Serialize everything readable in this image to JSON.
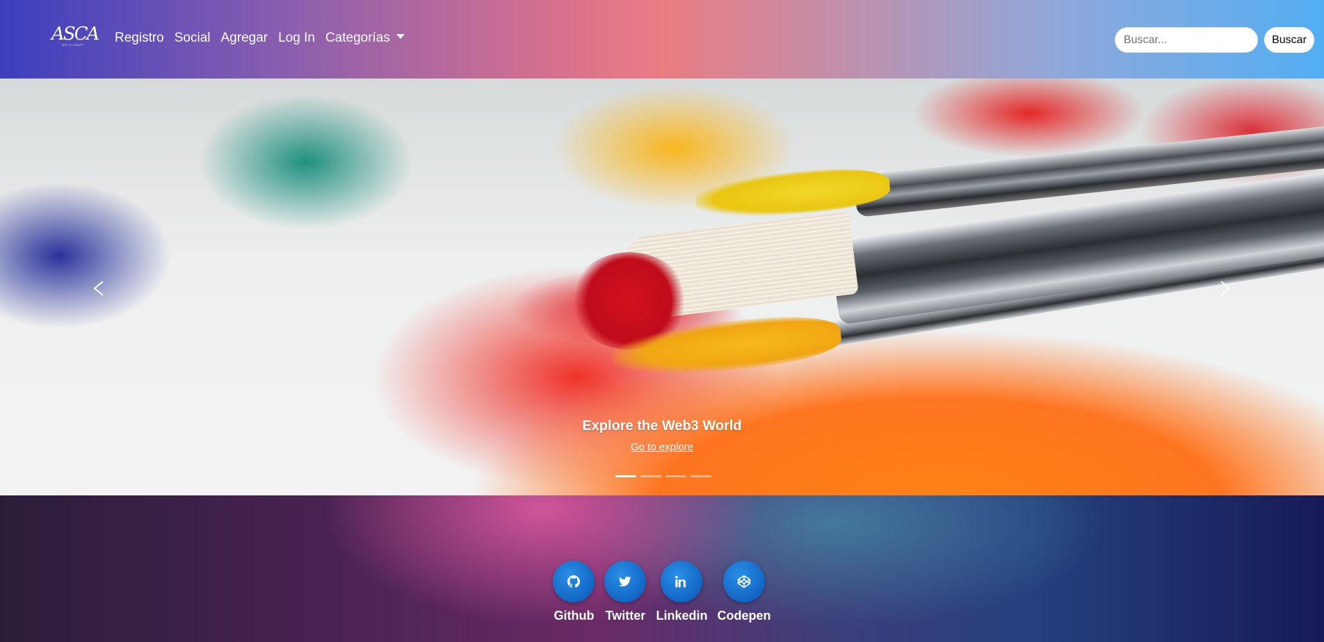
{
  "navbar": {
    "brand": {
      "monogram": "ASCA",
      "tagline": "ART & CRAFT"
    },
    "links": [
      "Registro",
      "Social",
      "Agregar",
      "Log In",
      "Categorías"
    ],
    "search": {
      "placeholder": "Buscar...",
      "value": "",
      "button": "Buscar"
    }
  },
  "carousel": {
    "caption_title": "Explore the Web3 World",
    "caption_link": "Go to explore",
    "slides": 4,
    "active_slide": 1,
    "icons": {
      "prev": "chevron-left-icon",
      "next": "chevron-right-icon"
    }
  },
  "footer": {
    "socials": [
      {
        "label": "Github",
        "icon": "github-icon"
      },
      {
        "label": "Twitter",
        "icon": "twitter-icon"
      },
      {
        "label": "Linkedin",
        "icon": "linkedin-icon"
      },
      {
        "label": "Codepen",
        "icon": "codepen-icon"
      }
    ],
    "accent_color": "#1266c4"
  }
}
